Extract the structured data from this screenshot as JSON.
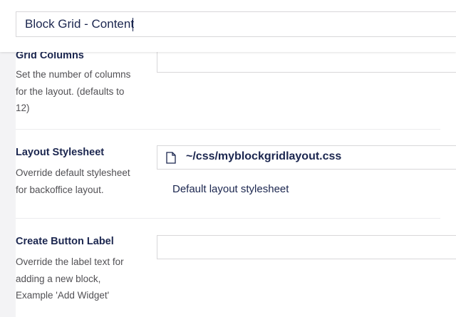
{
  "header": {
    "name_value": "Block Grid - Content"
  },
  "properties": {
    "grid_columns": {
      "label": "Grid Columns",
      "description": "Set the number of columns for the layout. (defaults to 12)",
      "value": ""
    },
    "layout_stylesheet": {
      "label": "Layout Stylesheet",
      "description": "Override default stylesheet for backoffice layout.",
      "file_path": "~/css/myblockgridlayout.css",
      "file_caption": "Default layout stylesheet",
      "file_icon": "document-icon"
    },
    "create_button_label": {
      "label": "Create Button Label",
      "description": "Override the label text for adding a new block, Example 'Add Widget'",
      "value": ""
    }
  },
  "colors": {
    "text_primary": "#1b264f",
    "text_secondary": "#515054",
    "border": "#d8d7d9",
    "gutter": "#f3f3f5"
  }
}
